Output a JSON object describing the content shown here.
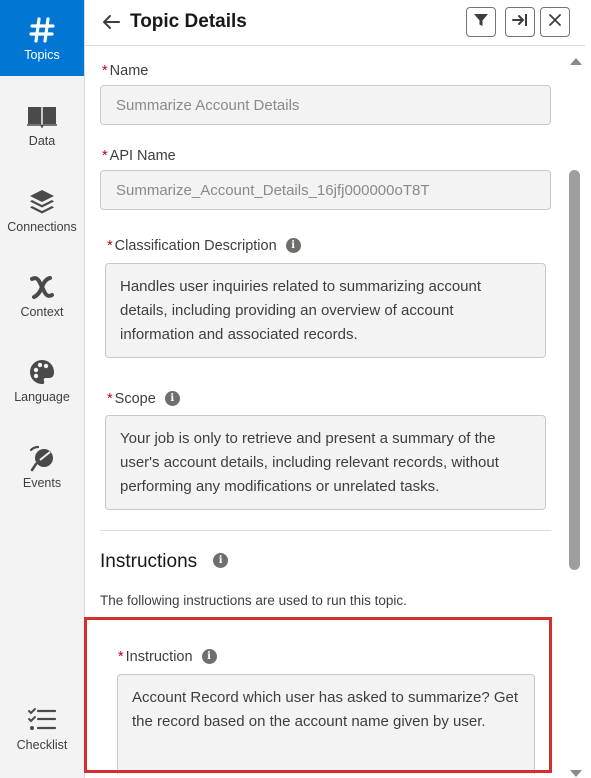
{
  "rail": {
    "items": [
      {
        "label": "Topics",
        "icon": "hash-icon",
        "active": true
      },
      {
        "label": "Data",
        "icon": "book-icon",
        "active": false
      },
      {
        "label": "Connections",
        "icon": "stack-icon",
        "active": false
      },
      {
        "label": "Context",
        "icon": "variable-icon",
        "active": false
      },
      {
        "label": "Language",
        "icon": "palette-icon",
        "active": false
      },
      {
        "label": "Events",
        "icon": "events-icon",
        "active": false
      }
    ],
    "checklist": {
      "label": "Checklist",
      "icon": "checklist-icon"
    }
  },
  "header": {
    "title": "Topic Details",
    "buttons": [
      "filter-icon",
      "collapse-right-icon",
      "close-icon"
    ]
  },
  "form": {
    "name": {
      "label": "Name",
      "value": "Summarize Account Details"
    },
    "api_name": {
      "label": "API Name",
      "value": "Summarize_Account_Details_16jfj000000oT8T"
    },
    "classification": {
      "label": "Classification Description",
      "value": "Handles user inquiries related to summarizing account details, including providing an overview of account information and associated records."
    },
    "scope": {
      "label": "Scope",
      "value": "Your job is only to retrieve and present a summary of the user's account details, including relevant records, without performing any modifications or unrelated tasks."
    }
  },
  "instructions": {
    "title": "Instructions",
    "help": "The following instructions are used to run this topic.",
    "instruction": {
      "label": "Instruction",
      "value": "Account Record which user has asked to summarize? Get the record based on the account name given by user."
    }
  },
  "colors": {
    "accent": "#0176d3",
    "highlight": "#d32f2f",
    "required": "#ba0517"
  }
}
